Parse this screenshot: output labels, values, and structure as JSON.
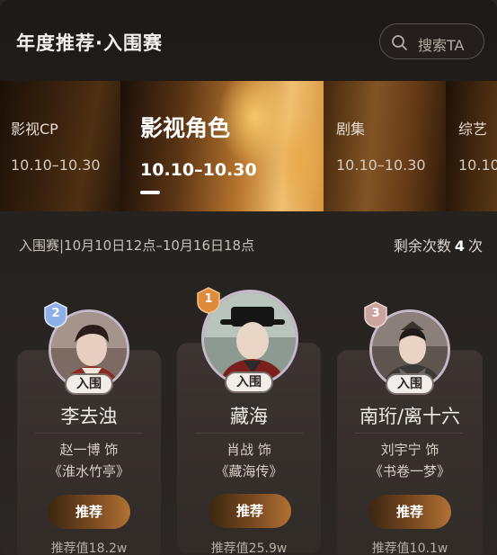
{
  "header": {
    "title": "年度推荐·入围赛",
    "search_placeholder": "搜索TA"
  },
  "tabs": [
    {
      "label": "影视CP",
      "dates": "10.10–10.30",
      "active": false
    },
    {
      "label": "影视角色",
      "dates": "10.10–10.30",
      "active": true
    },
    {
      "label": "剧集",
      "dates": "10.10–10.30",
      "active": false
    },
    {
      "label": "综艺",
      "dates": "10.10",
      "active": false
    }
  ],
  "info": {
    "schedule": "入围赛|10月10日12点–10月16日18点",
    "remaining_label": "剩余次数",
    "remaining_count": "4",
    "remaining_unit": "次"
  },
  "cards": [
    {
      "rank": "2",
      "badge": "入围",
      "name": "李去浊",
      "actor": "赵一博 饰",
      "show": "《淮水竹亭》",
      "button": "推荐",
      "score": "推荐值18.2w"
    },
    {
      "rank": "1",
      "badge": "入围",
      "name": "藏海",
      "actor": "肖战 饰",
      "show": "《藏海传》",
      "button": "推荐",
      "score": "推荐值25.9w"
    },
    {
      "rank": "3",
      "badge": "入围",
      "name": "南珩/离十六",
      "actor": "刘宇宁 饰",
      "show": "《书卷一梦》",
      "button": "推荐",
      "score": "推荐值10.1w"
    }
  ],
  "colors": {
    "background": "#262220",
    "accent": "#b07134",
    "rank1": "#e08a3c",
    "rank2": "#8fb0e6",
    "rank3": "#c9a59d"
  }
}
